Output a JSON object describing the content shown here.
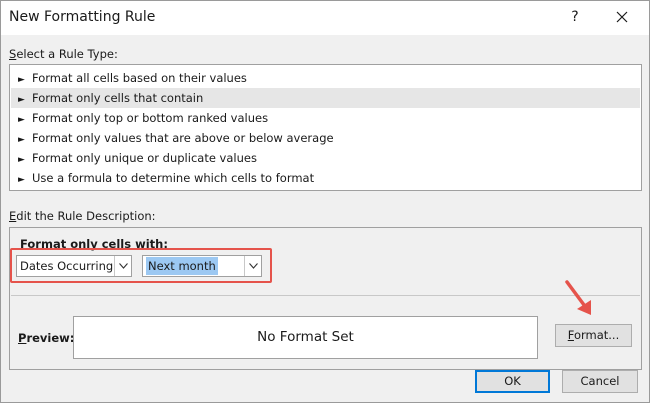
{
  "window": {
    "title": "New Formatting Rule",
    "help_label": "?",
    "close_icon": "close-icon"
  },
  "rule_type": {
    "section_label_first": "S",
    "section_label_rest": "elect a Rule Type:",
    "bullet": "►",
    "items": [
      {
        "label": "Format all cells based on their values",
        "selected": false
      },
      {
        "label": "Format only cells that contain",
        "selected": true
      },
      {
        "label": "Format only top or bottom ranked values",
        "selected": false
      },
      {
        "label": "Format only values that are above or below average",
        "selected": false
      },
      {
        "label": "Format only unique or duplicate values",
        "selected": false
      },
      {
        "label": "Use a formula to determine which cells to format",
        "selected": false
      }
    ]
  },
  "rule_description": {
    "section_label_first": "E",
    "section_label_rest": "dit the Rule Description:",
    "heading_first": "F",
    "heading_rest": "ormat only cells with:",
    "condition_type": "Dates Occurring",
    "condition_value": "Next month",
    "highlight_color": "#e5534b",
    "preview_label_first": "P",
    "preview_label_rest": "review:",
    "preview_text": "No Format Set",
    "format_button_first": "F",
    "format_button_rest": "ormat..."
  },
  "footer": {
    "ok_label": "OK",
    "cancel_label": "Cancel"
  },
  "colors": {
    "accent_blue": "#0078d7",
    "selection_blue": "#9cc8f2",
    "annotation_red": "#e5534b"
  }
}
